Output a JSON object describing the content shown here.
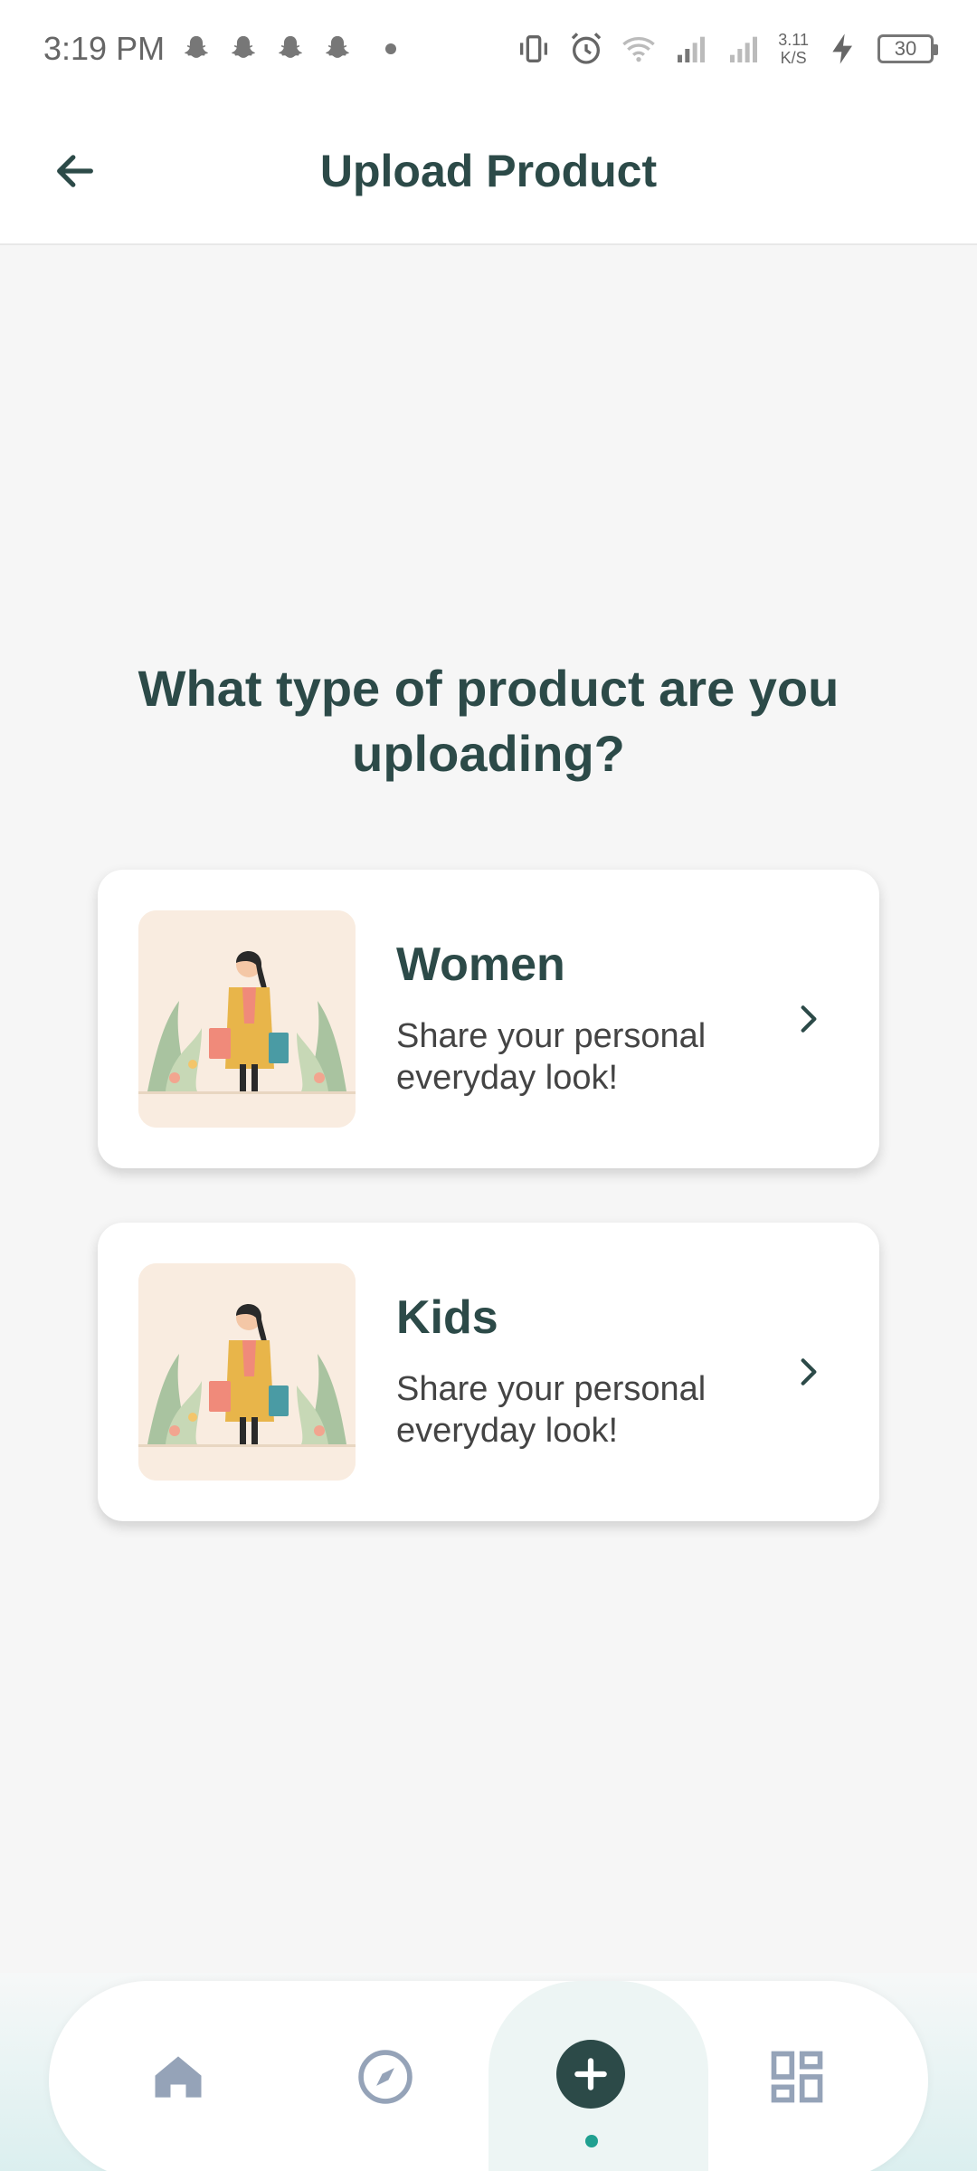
{
  "status_bar": {
    "time": "3:19 PM",
    "net_speed_value": "3.11",
    "net_speed_unit": "K/S",
    "battery": "30"
  },
  "header": {
    "title": "Upload Product"
  },
  "main": {
    "question": "What type of product are you uploading?",
    "options": [
      {
        "title": "Women",
        "description": "Share your personal everyday look!"
      },
      {
        "title": "Kids",
        "description": "Share your personal everyday look!"
      }
    ]
  },
  "bottom_nav": {
    "items": [
      "home-icon",
      "compass-icon",
      "plus-icon",
      "dashboard-icon"
    ],
    "active": "plus-icon",
    "accent": "#2c4a48",
    "indicator": "#20a090",
    "inactive": "#95a3b8"
  }
}
